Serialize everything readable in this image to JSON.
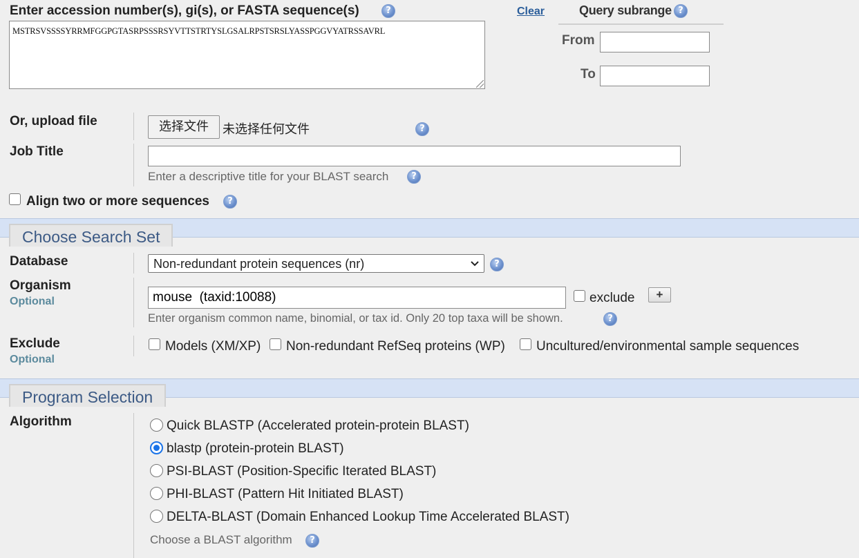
{
  "query": {
    "label": "Enter accession number(s), gi(s), or FASTA sequence(s)",
    "clear_label": "Clear",
    "sequence": "MSTRSVSSSSYRRMFGGPGTASRPSSSRSYVTTSTRTYSLGSALRPSTSRSLYASSPGGVYATRSSAVRL"
  },
  "subrange": {
    "title": "Query subrange",
    "from_label": "From",
    "to_label": "To",
    "from_value": "",
    "to_value": ""
  },
  "upload": {
    "label": "Or, upload file",
    "button_label": "选择文件",
    "status": "未选择任何文件"
  },
  "job_title": {
    "label": "Job Title",
    "value": "",
    "hint": "Enter a descriptive title for your BLAST search"
  },
  "align_two": {
    "label": "Align two or more sequences",
    "checked": false
  },
  "search_set": {
    "heading": "Choose Search Set",
    "database_label": "Database",
    "database_value": "Non-redundant protein sequences (nr)",
    "organism_label": "Organism",
    "organism_optional": "Optional",
    "organism_value": "mouse  (taxid:10088)",
    "exclude_label": "exclude",
    "add_button": "+",
    "organism_hint": "Enter organism common name, binomial, or tax id. Only 20 top taxa will be shown.",
    "exclude_section_label": "Exclude",
    "exclude_optional": "Optional",
    "exclude_options": [
      "Models (XM/XP)",
      "Non-redundant RefSeq proteins (WP)",
      "Uncultured/environmental sample sequences"
    ]
  },
  "program": {
    "heading": "Program Selection",
    "algorithm_label": "Algorithm",
    "options": [
      {
        "name": "Quick BLASTP",
        "desc": "(Accelerated protein-protein BLAST)",
        "selected": false
      },
      {
        "name": "blastp",
        "desc": "(protein-protein BLAST)",
        "selected": true
      },
      {
        "name": "PSI-BLAST",
        "desc": "(Position-Specific Iterated BLAST)",
        "selected": false
      },
      {
        "name": "PHI-BLAST",
        "desc": "(Pattern Hit Initiated BLAST)",
        "selected": false
      },
      {
        "name": "DELTA-BLAST",
        "desc": "(Domain Enhanced Lookup Time Accelerated BLAST)",
        "selected": false
      }
    ],
    "hint": "Choose a BLAST algorithm"
  },
  "colors": {
    "section_band": "#d6e2f5",
    "section_heading": "#3c5a85",
    "link": "#2a5d9a",
    "optional": "#5b8a9d",
    "radio_selected": "#1a73e8"
  }
}
